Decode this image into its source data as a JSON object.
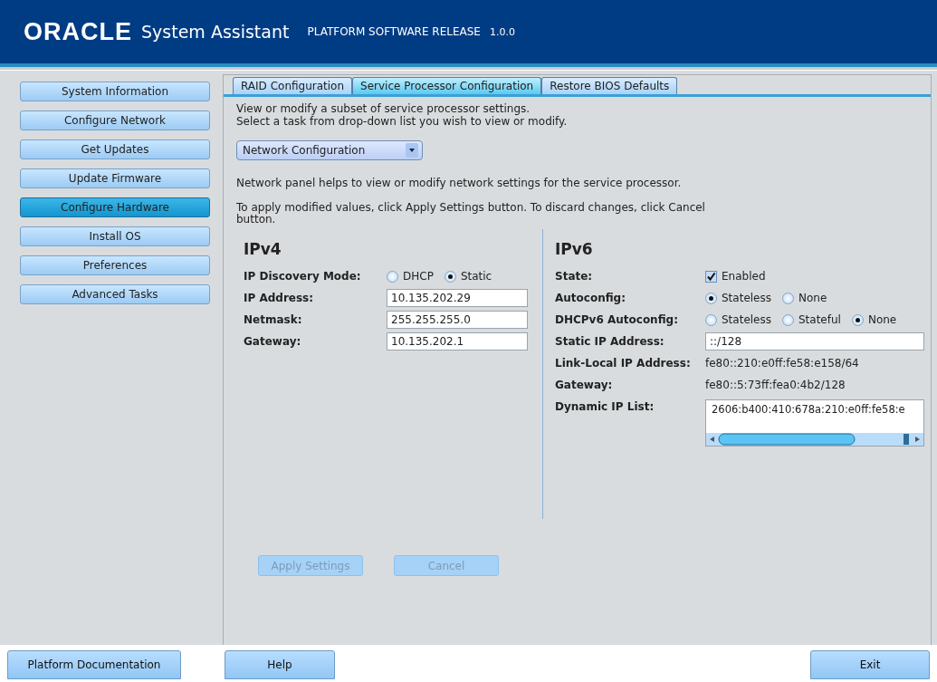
{
  "header": {
    "logo": "ORACLE",
    "product": "System Assistant",
    "release_label": "PLATFORM SOFTWARE RELEASE",
    "version": "1.0.0"
  },
  "sidebar": {
    "items": [
      {
        "label": "System Information",
        "selected": false
      },
      {
        "label": "Configure Network",
        "selected": false
      },
      {
        "label": "Get Updates",
        "selected": false
      },
      {
        "label": "Update Firmware",
        "selected": false
      },
      {
        "label": "Configure Hardware",
        "selected": true
      },
      {
        "label": "Install OS",
        "selected": false
      },
      {
        "label": "Preferences",
        "selected": false
      },
      {
        "label": "Advanced Tasks",
        "selected": false
      }
    ]
  },
  "tabs": [
    {
      "label": "RAID Configuration",
      "selected": false
    },
    {
      "label": "Service Processor Configuration",
      "selected": true
    },
    {
      "label": "Restore BIOS Defaults",
      "selected": false
    }
  ],
  "intro": [
    "View or modify a subset of service processor settings.",
    "Select a task from drop-down list you wish to view or modify."
  ],
  "task_dropdown": {
    "value": "Network Configuration"
  },
  "description": "Network panel helps to view or modify network settings for the service processor.",
  "apply_note": "To apply modified values, click Apply Settings button. To discard changes, click Cancel button.",
  "ipv4": {
    "title": "IPv4",
    "rows": [
      {
        "kind": "radio",
        "label": "IP Discovery Mode:",
        "options": [
          {
            "label": "DHCP",
            "selected": false
          },
          {
            "label": "Static",
            "selected": true
          }
        ]
      },
      {
        "kind": "field",
        "label": "IP Address:",
        "value": "10.135.202.29"
      },
      {
        "kind": "field",
        "label": "Netmask:",
        "value": "255.255.255.0"
      },
      {
        "kind": "field",
        "label": "Gateway:",
        "value": "10.135.202.1"
      }
    ]
  },
  "ipv6": {
    "title": "IPv6",
    "rows": [
      {
        "kind": "checkbox",
        "label": "State:",
        "option": "Enabled",
        "checked": true
      },
      {
        "kind": "radio",
        "label": "Autoconfig:",
        "options": [
          {
            "label": "Stateless",
            "selected": true
          },
          {
            "label": "None",
            "selected": false
          }
        ]
      },
      {
        "kind": "radio",
        "label": "DHCPv6 Autoconfig:",
        "options": [
          {
            "label": "Stateless",
            "selected": false
          },
          {
            "label": "Stateful",
            "selected": false
          },
          {
            "label": "None",
            "selected": true
          }
        ]
      },
      {
        "kind": "field",
        "label": "Static IP Address:",
        "value": "::/128"
      },
      {
        "kind": "text",
        "label": "Link-Local IP Address:",
        "value": "fe80::210:e0ff:fe58:e158/64"
      },
      {
        "kind": "text",
        "label": "Gateway:",
        "value": "fe80::5:73ff:fea0:4b2/128"
      },
      {
        "kind": "list",
        "label": "Dynamic IP List:",
        "value": "2606:b400:410:678a:210:e0ff:fe58:e"
      }
    ]
  },
  "actions": [
    {
      "label": "Apply Settings",
      "disabled": true
    },
    {
      "label": "Cancel",
      "disabled": true
    }
  ],
  "footer": {
    "left": [
      "Platform Documentation",
      "Help"
    ],
    "right": [
      "Exit"
    ]
  }
}
